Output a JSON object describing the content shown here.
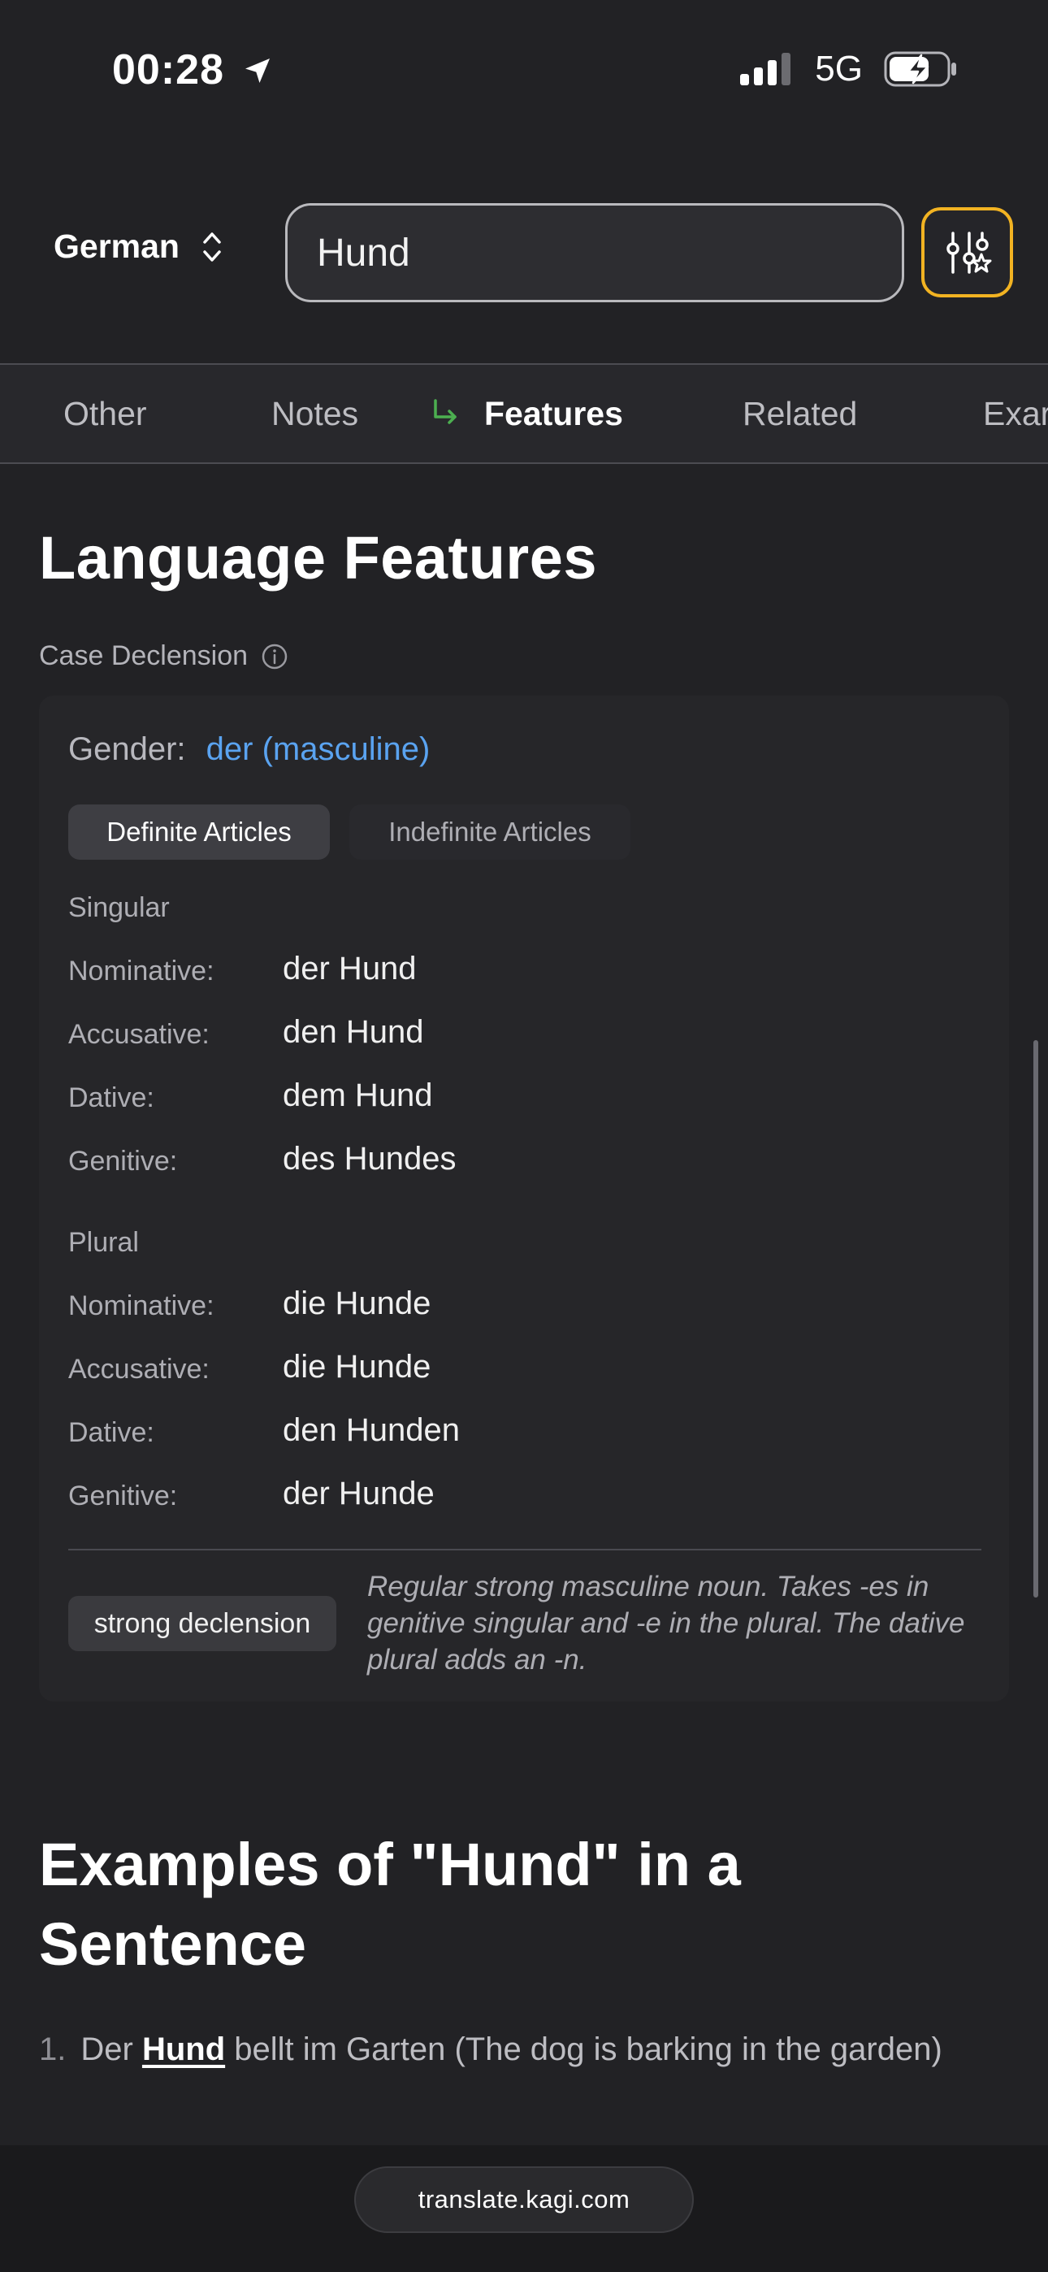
{
  "status_bar": {
    "time": "00:28",
    "network": "5G"
  },
  "header": {
    "language": "German",
    "search_value": "Hund"
  },
  "tabs": [
    "Other",
    "Notes",
    "Features",
    "Related",
    "Exar"
  ],
  "language_features": {
    "title": "Language Features",
    "case_label": "Case Declension",
    "gender_label": "Gender:",
    "gender_value": "der (masculine)",
    "article_tabs": {
      "definite": "Definite Articles",
      "indefinite": "Indefinite Articles"
    },
    "singular": {
      "heading": "Singular",
      "rows": [
        {
          "case": "Nominative:",
          "form": "der Hund"
        },
        {
          "case": "Accusative:",
          "form": "den Hund"
        },
        {
          "case": "Dative:",
          "form": "dem Hund"
        },
        {
          "case": "Genitive:",
          "form": "des Hundes"
        }
      ]
    },
    "plural": {
      "heading": "Plural",
      "rows": [
        {
          "case": "Nominative:",
          "form": "die Hunde"
        },
        {
          "case": "Accusative:",
          "form": "die Hunde"
        },
        {
          "case": "Dative:",
          "form": "den Hunden"
        },
        {
          "case": "Genitive:",
          "form": "der Hunde"
        }
      ]
    },
    "declension_badge": "strong declension",
    "declension_note": "Regular strong masculine noun. Takes -es in genitive singular and -e in the plural. The dative plural adds an -n."
  },
  "examples": {
    "title": "Examples of \"Hund\" in a Sentence",
    "items": [
      {
        "number": "1.",
        "before": "Der ",
        "highlight": "Hund",
        "after": " bellt im Garten (The dog is barking in the garden)"
      }
    ]
  },
  "browser": {
    "url": "translate.kagi.com"
  },
  "colors": {
    "accent_filter": "#f2b322",
    "gender_link": "#5aa3f0",
    "active_tab_arrow": "#4caf50"
  }
}
